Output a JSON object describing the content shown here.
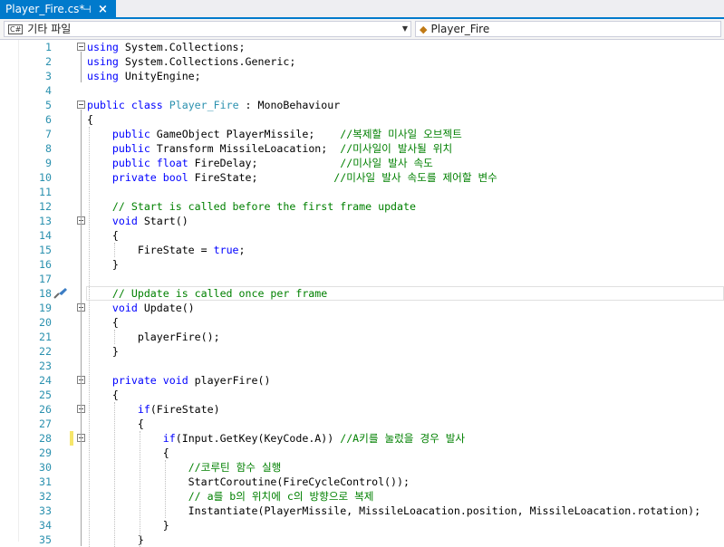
{
  "tab": {
    "title": "Player_Fire.cs*",
    "pin": "⊣",
    "close": "×"
  },
  "nav": {
    "left_badge": "C#",
    "left_label": "기타 파일",
    "right_label": "Player_Fire"
  },
  "colors": {
    "accent": "#007acc",
    "keyword": "#0000ff",
    "type": "#2b91af",
    "comment": "#008000"
  },
  "lines": [
    {
      "n": "1",
      "tokens": [
        [
          "k",
          "using"
        ],
        [
          "p",
          " System.Collections;"
        ]
      ]
    },
    {
      "n": "2",
      "tokens": [
        [
          "k",
          "using"
        ],
        [
          "p",
          " System.Collections.Generic;"
        ]
      ]
    },
    {
      "n": "3",
      "tokens": [
        [
          "k",
          "using"
        ],
        [
          "p",
          " UnityEngine;"
        ]
      ]
    },
    {
      "n": "4",
      "tokens": []
    },
    {
      "n": "5",
      "tokens": [
        [
          "k",
          "public"
        ],
        [
          "p",
          " "
        ],
        [
          "k",
          "class"
        ],
        [
          "p",
          " "
        ],
        [
          "t",
          "Player_Fire"
        ],
        [
          "p",
          " : MonoBehaviour"
        ]
      ]
    },
    {
      "n": "6",
      "tokens": [
        [
          "p",
          "{"
        ]
      ]
    },
    {
      "n": "7",
      "tokens": [
        [
          "p",
          "    "
        ],
        [
          "k",
          "public"
        ],
        [
          "p",
          " GameObject PlayerMissile;    "
        ],
        [
          "c",
          "//복제할 미사일 오브젝트"
        ]
      ]
    },
    {
      "n": "8",
      "tokens": [
        [
          "p",
          "    "
        ],
        [
          "k",
          "public"
        ],
        [
          "p",
          " Transform MissileLoacation;  "
        ],
        [
          "c",
          "//미사일이 발사될 위치"
        ]
      ]
    },
    {
      "n": "9",
      "tokens": [
        [
          "p",
          "    "
        ],
        [
          "k",
          "public"
        ],
        [
          "p",
          " "
        ],
        [
          "k",
          "float"
        ],
        [
          "p",
          " FireDelay;             "
        ],
        [
          "c",
          "//미사일 발사 속도"
        ]
      ]
    },
    {
      "n": "10",
      "tokens": [
        [
          "p",
          "    "
        ],
        [
          "k",
          "private"
        ],
        [
          "p",
          " "
        ],
        [
          "k",
          "bool"
        ],
        [
          "p",
          " FireState;            "
        ],
        [
          "c",
          "//미사일 발사 속도를 제어할 변수"
        ]
      ]
    },
    {
      "n": "11",
      "tokens": []
    },
    {
      "n": "12",
      "tokens": [
        [
          "p",
          "    "
        ],
        [
          "c",
          "// Start is called before the first frame update"
        ]
      ]
    },
    {
      "n": "13",
      "tokens": [
        [
          "p",
          "    "
        ],
        [
          "k",
          "void"
        ],
        [
          "p",
          " Start()"
        ]
      ]
    },
    {
      "n": "14",
      "tokens": [
        [
          "p",
          "    {"
        ]
      ]
    },
    {
      "n": "15",
      "tokens": [
        [
          "p",
          "        FireState = "
        ],
        [
          "k",
          "true"
        ],
        [
          "p",
          ";"
        ]
      ]
    },
    {
      "n": "16",
      "tokens": [
        [
          "p",
          "    }"
        ]
      ]
    },
    {
      "n": "17",
      "tokens": []
    },
    {
      "n": "18",
      "tokens": [
        [
          "p",
          "    "
        ],
        [
          "c",
          "// Update is called once per frame"
        ]
      ]
    },
    {
      "n": "19",
      "tokens": [
        [
          "p",
          "    "
        ],
        [
          "k",
          "void"
        ],
        [
          "p",
          " Update()"
        ]
      ]
    },
    {
      "n": "20",
      "tokens": [
        [
          "p",
          "    {"
        ]
      ]
    },
    {
      "n": "21",
      "tokens": [
        [
          "p",
          "        playerFire();"
        ]
      ]
    },
    {
      "n": "22",
      "tokens": [
        [
          "p",
          "    }"
        ]
      ]
    },
    {
      "n": "23",
      "tokens": []
    },
    {
      "n": "24",
      "tokens": [
        [
          "p",
          "    "
        ],
        [
          "k",
          "private"
        ],
        [
          "p",
          " "
        ],
        [
          "k",
          "void"
        ],
        [
          "p",
          " playerFire()"
        ]
      ]
    },
    {
      "n": "25",
      "tokens": [
        [
          "p",
          "    {"
        ]
      ]
    },
    {
      "n": "26",
      "tokens": [
        [
          "p",
          "        "
        ],
        [
          "k",
          "if"
        ],
        [
          "p",
          "(FireState)"
        ]
      ]
    },
    {
      "n": "27",
      "tokens": [
        [
          "p",
          "        {"
        ]
      ]
    },
    {
      "n": "28",
      "tokens": [
        [
          "p",
          "            "
        ],
        [
          "k",
          "if"
        ],
        [
          "p",
          "(Input.GetKey(KeyCode.A)) "
        ],
        [
          "c",
          "//A키를 눌렀을 경우 발사"
        ]
      ]
    },
    {
      "n": "29",
      "tokens": [
        [
          "p",
          "            {"
        ]
      ]
    },
    {
      "n": "30",
      "tokens": [
        [
          "p",
          "                "
        ],
        [
          "c",
          "//코루틴 함수 실행"
        ]
      ]
    },
    {
      "n": "31",
      "tokens": [
        [
          "p",
          "                StartCoroutine(FireCycleControl());"
        ]
      ]
    },
    {
      "n": "32",
      "tokens": [
        [
          "p",
          "                "
        ],
        [
          "c",
          "// a를 b의 위치에 c의 방향으로 복제"
        ]
      ]
    },
    {
      "n": "33",
      "tokens": [
        [
          "p",
          "                Instantiate(PlayerMissile, MissileLoacation.position, MissileLoacation.rotation);"
        ]
      ]
    },
    {
      "n": "34",
      "tokens": [
        [
          "p",
          "            }"
        ]
      ]
    },
    {
      "n": "35",
      "tokens": [
        [
          "p",
          "        }"
        ]
      ]
    }
  ]
}
